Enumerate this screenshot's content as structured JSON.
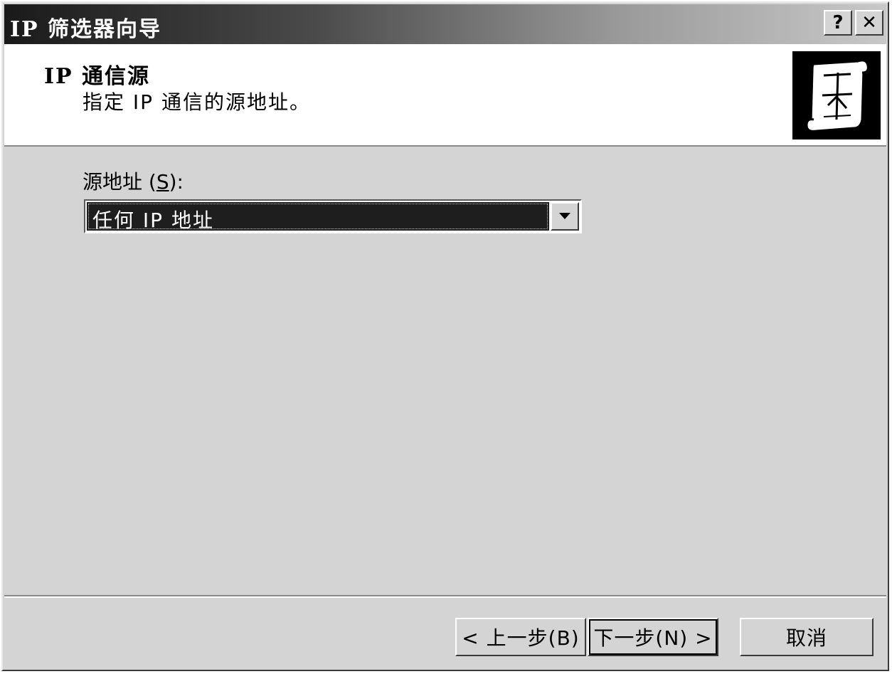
{
  "window": {
    "title": "IP 筛选器向导",
    "help_label": "?",
    "close_label": "✕"
  },
  "header": {
    "title": "IP 通信源",
    "subtitle": "指定 IP 通信的源地址。",
    "icon": "scroll-icon"
  },
  "main": {
    "source_label_prefix": "源地址 (",
    "source_label_accel": "S",
    "source_label_suffix": "):",
    "source_selected": "任何 IP 地址"
  },
  "footer": {
    "back_label": "< 上一步(B)",
    "next_label": "下一步(N) >",
    "cancel_label": "取消"
  }
}
